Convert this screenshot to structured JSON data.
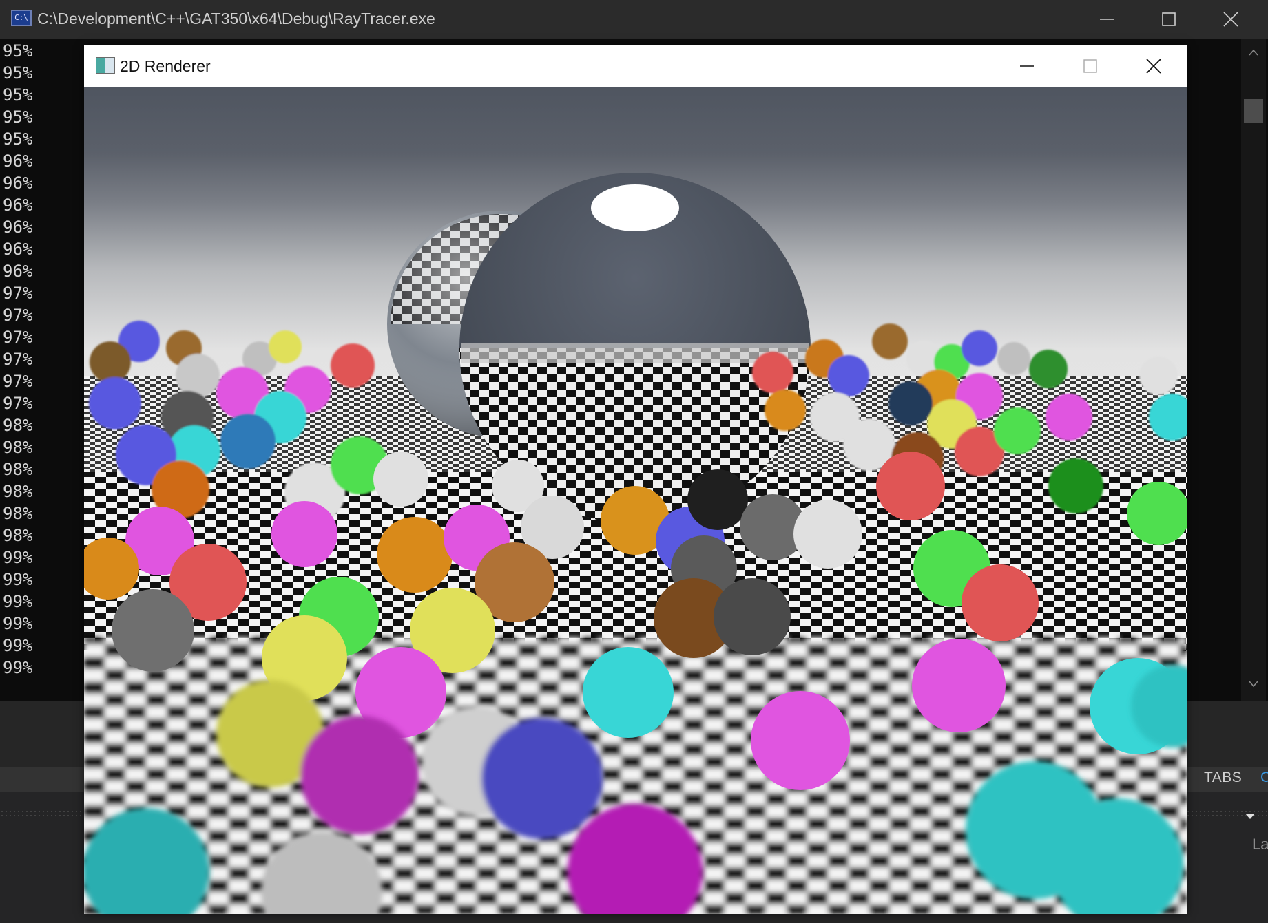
{
  "console_window": {
    "title": "C:\\Development\\C++\\GAT350\\x64\\Debug\\RayTracer.exe",
    "icon": "console-app-icon",
    "icon_text": "C:\\",
    "progress_lines": [
      "95%",
      "95%",
      "95%",
      "95%",
      "95%",
      "96%",
      "96%",
      "96%",
      "96%",
      "96%",
      "96%",
      "97%",
      "97%",
      "97%",
      "97%",
      "97%",
      "97%",
      "98%",
      "98%",
      "98%",
      "98%",
      "98%",
      "98%",
      "99%",
      "99%",
      "99%",
      "99%",
      "99%",
      "99%"
    ]
  },
  "renderer_window": {
    "title": "2D Renderer",
    "icon": "app-window-icon"
  },
  "ide_background": {
    "tabs_label": "TABS",
    "tabs_edge_glyph": "C",
    "partial_label": "La"
  },
  "colors": {
    "console_bg": "#0c0c0c",
    "console_titlebar": "#2b2b2b",
    "console_text": "#d4d4d4",
    "renderer_titlebar": "#ffffff",
    "ide_accent": "#3a96dd"
  }
}
